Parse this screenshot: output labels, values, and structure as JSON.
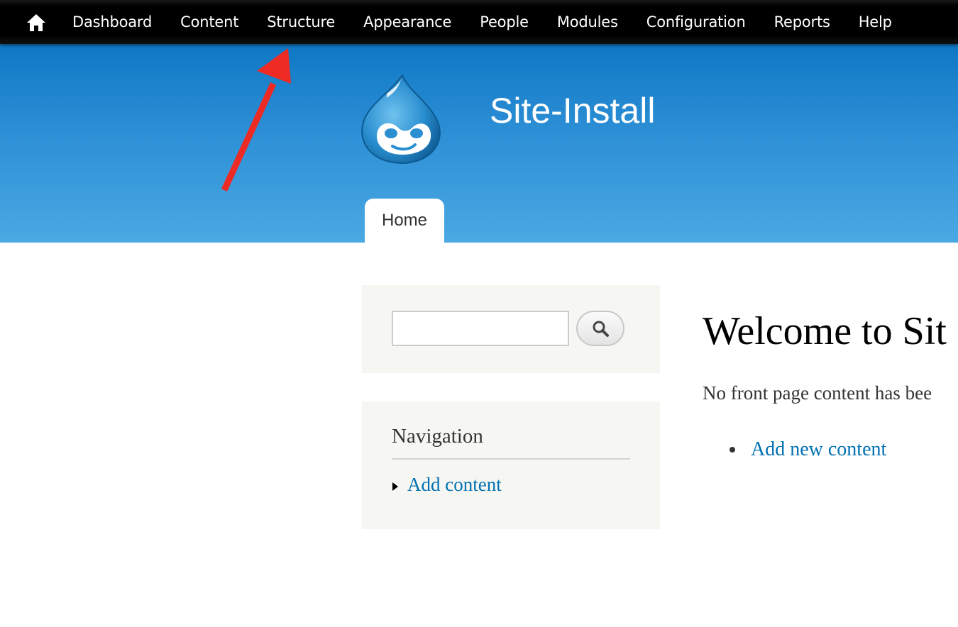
{
  "toolbar": {
    "home_icon": "home-icon",
    "menu": [
      {
        "label": "Dashboard"
      },
      {
        "label": "Content"
      },
      {
        "label": "Structure"
      },
      {
        "label": "Appearance"
      },
      {
        "label": "People"
      },
      {
        "label": "Modules"
      },
      {
        "label": "Configuration"
      },
      {
        "label": "Reports"
      },
      {
        "label": "Help"
      }
    ]
  },
  "header": {
    "logo_icon": "drupal-drop-logo",
    "site_name": "Site-Install",
    "tabs": [
      {
        "label": "Home"
      }
    ],
    "colors": {
      "top": "#0e78c4",
      "bottom": "#4aa9e3"
    }
  },
  "sidebar": {
    "search": {
      "value": "",
      "button_icon": "magnifier-icon"
    },
    "navigation": {
      "title": "Navigation",
      "items": [
        {
          "label": "Add content"
        }
      ]
    }
  },
  "main": {
    "title": "Welcome to Sit",
    "text": "No front page content has bee",
    "links": [
      {
        "label": "Add new content"
      }
    ]
  },
  "annotation": {
    "arrow_icon": "red-annotation-arrow",
    "color": "#ee2a24"
  },
  "colors": {
    "link": "#0071b3",
    "sidebar_bg": "#f6f6f2",
    "toolbar_bg": "#000000"
  }
}
